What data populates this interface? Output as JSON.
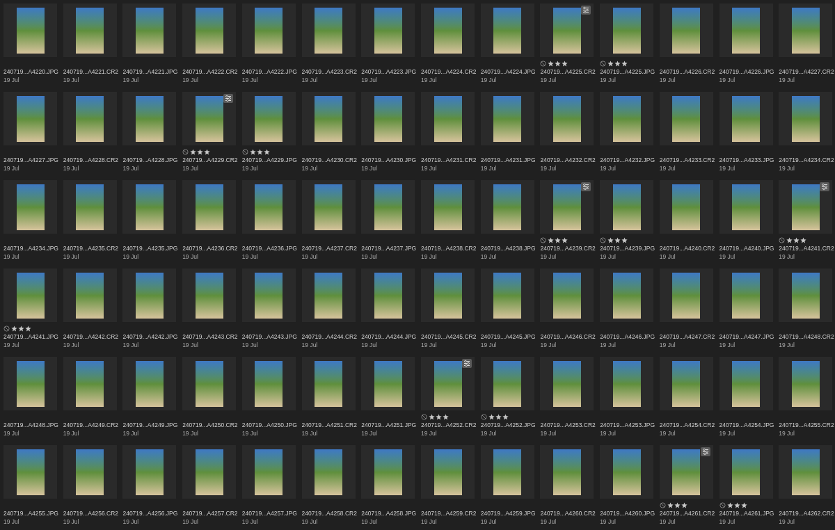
{
  "photos": [
    {
      "name": "240719...A4220.JPG",
      "date": "19 Jul",
      "edited": false
    },
    {
      "name": "240719...A4221.CR2",
      "date": "19 Jul",
      "edited": false
    },
    {
      "name": "240719...A4221.JPG",
      "date": "19 Jul",
      "edited": false
    },
    {
      "name": "240719...A4222.CR2",
      "date": "19 Jul",
      "edited": false
    },
    {
      "name": "240719...A4222.JPG",
      "date": "19 Jul",
      "edited": false
    },
    {
      "name": "240719...A4223.CR2",
      "date": "19 Jul",
      "edited": false
    },
    {
      "name": "240719...A4223.JPG",
      "date": "19 Jul",
      "edited": false
    },
    {
      "name": "240719...A4224.CR2",
      "date": "19 Jul",
      "edited": false
    },
    {
      "name": "240719...A4224.JPG",
      "date": "19 Jul",
      "edited": false
    },
    {
      "name": "240719...A4225.CR2",
      "date": "19 Jul",
      "edited": true,
      "stars": 3
    },
    {
      "name": "240719...A4225.JPG",
      "date": "19 Jul",
      "edited": false,
      "stars": 3
    },
    {
      "name": "240719...A4226.CR2",
      "date": "19 Jul",
      "edited": false
    },
    {
      "name": "240719...A4226.JPG",
      "date": "19 Jul",
      "edited": false
    },
    {
      "name": "240719...A4227.CR2",
      "date": "19 Jul",
      "edited": false
    },
    {
      "name": "240719...A4227.JPG",
      "date": "19 Jul",
      "edited": false
    },
    {
      "name": "240719...A4228.CR2",
      "date": "19 Jul",
      "edited": false
    },
    {
      "name": "240719...A4228.JPG",
      "date": "19 Jul",
      "edited": false
    },
    {
      "name": "240719...A4229.CR2",
      "date": "19 Jul",
      "edited": true,
      "stars": 3
    },
    {
      "name": "240719...A4229.JPG",
      "date": "19 Jul",
      "edited": false,
      "stars": 3
    },
    {
      "name": "240719...A4230.CR2",
      "date": "19 Jul",
      "edited": false
    },
    {
      "name": "240719...A4230.JPG",
      "date": "19 Jul",
      "edited": false
    },
    {
      "name": "240719...A4231.CR2",
      "date": "19 Jul",
      "edited": false
    },
    {
      "name": "240719...A4231.JPG",
      "date": "19 Jul",
      "edited": false
    },
    {
      "name": "240719...A4232.CR2",
      "date": "19 Jul",
      "edited": false
    },
    {
      "name": "240719...A4232.JPG",
      "date": "19 Jul",
      "edited": false
    },
    {
      "name": "240719...A4233.CR2",
      "date": "19 Jul",
      "edited": false
    },
    {
      "name": "240719...A4233.JPG",
      "date": "19 Jul",
      "edited": false
    },
    {
      "name": "240719...A4234.CR2",
      "date": "19 Jul",
      "edited": false
    },
    {
      "name": "240719...A4234.JPG",
      "date": "19 Jul",
      "edited": false
    },
    {
      "name": "240719...A4235.CR2",
      "date": "19 Jul",
      "edited": false
    },
    {
      "name": "240719...A4235.JPG",
      "date": "19 Jul",
      "edited": false
    },
    {
      "name": "240719...A4236.CR2",
      "date": "19 Jul",
      "edited": false
    },
    {
      "name": "240719...A4236.JPG",
      "date": "19 Jul",
      "edited": false
    },
    {
      "name": "240719...A4237.CR2",
      "date": "19 Jul",
      "edited": false
    },
    {
      "name": "240719...A4237.JPG",
      "date": "19 Jul",
      "edited": false
    },
    {
      "name": "240719...A4238.CR2",
      "date": "19 Jul",
      "edited": false
    },
    {
      "name": "240719...A4238.JPG",
      "date": "19 Jul",
      "edited": false
    },
    {
      "name": "240719...A4239.CR2",
      "date": "19 Jul",
      "edited": true,
      "stars": 3
    },
    {
      "name": "240719...A4239.JPG",
      "date": "19 Jul",
      "edited": false,
      "stars": 3
    },
    {
      "name": "240719...A4240.CR2",
      "date": "19 Jul",
      "edited": false
    },
    {
      "name": "240719...A4240.JPG",
      "date": "19 Jul",
      "edited": false
    },
    {
      "name": "240719...A4241.CR2",
      "date": "19 Jul",
      "edited": true,
      "stars": 3
    },
    {
      "name": "240719...A4241.JPG",
      "date": "19 Jul",
      "edited": false,
      "stars": 3
    },
    {
      "name": "240719...A4242.CR2",
      "date": "19 Jul",
      "edited": false
    },
    {
      "name": "240719...A4242.JPG",
      "date": "19 Jul",
      "edited": false
    },
    {
      "name": "240719...A4243.CR2",
      "date": "19 Jul",
      "edited": false
    },
    {
      "name": "240719...A4243.JPG",
      "date": "19 Jul",
      "edited": false
    },
    {
      "name": "240719...A4244.CR2",
      "date": "19 Jul",
      "edited": false
    },
    {
      "name": "240719...A4244.JPG",
      "date": "19 Jul",
      "edited": false
    },
    {
      "name": "240719...A4245.CR2",
      "date": "19 Jul",
      "edited": false
    },
    {
      "name": "240719...A4245.JPG",
      "date": "19 Jul",
      "edited": false
    },
    {
      "name": "240719...A4246.CR2",
      "date": "19 Jul",
      "edited": false
    },
    {
      "name": "240719...A4246.JPG",
      "date": "19 Jul",
      "edited": false
    },
    {
      "name": "240719...A4247.CR2",
      "date": "19 Jul",
      "edited": false
    },
    {
      "name": "240719...A4247.JPG",
      "date": "19 Jul",
      "edited": false
    },
    {
      "name": "240719...A4248.CR2",
      "date": "19 Jul",
      "edited": false
    },
    {
      "name": "240719...A4248.JPG",
      "date": "19 Jul",
      "edited": false
    },
    {
      "name": "240719...A4249.CR2",
      "date": "19 Jul",
      "edited": false
    },
    {
      "name": "240719...A4249.JPG",
      "date": "19 Jul",
      "edited": false
    },
    {
      "name": "240719...A4250.CR2",
      "date": "19 Jul",
      "edited": false
    },
    {
      "name": "240719...A4250.JPG",
      "date": "19 Jul",
      "edited": false
    },
    {
      "name": "240719...A4251.CR2",
      "date": "19 Jul",
      "edited": false
    },
    {
      "name": "240719...A4251.JPG",
      "date": "19 Jul",
      "edited": false
    },
    {
      "name": "240719...A4252.CR2",
      "date": "19 Jul",
      "edited": true,
      "stars": 3
    },
    {
      "name": "240719...A4252.JPG",
      "date": "19 Jul",
      "edited": false,
      "stars": 3
    },
    {
      "name": "240719...A4253.CR2",
      "date": "19 Jul",
      "edited": false
    },
    {
      "name": "240719...A4253.JPG",
      "date": "19 Jul",
      "edited": false
    },
    {
      "name": "240719...A4254.CR2",
      "date": "19 Jul",
      "edited": false
    },
    {
      "name": "240719...A4254.JPG",
      "date": "19 Jul",
      "edited": false
    },
    {
      "name": "240719...A4255.CR2",
      "date": "19 Jul",
      "edited": false
    },
    {
      "name": "240719...A4255.JPG",
      "date": "19 Jul",
      "edited": false
    },
    {
      "name": "240719...A4256.CR2",
      "date": "19 Jul",
      "edited": false
    },
    {
      "name": "240719...A4256.JPG",
      "date": "19 Jul",
      "edited": false
    },
    {
      "name": "240719...A4257.CR2",
      "date": "19 Jul",
      "edited": false
    },
    {
      "name": "240719...A4257.JPG",
      "date": "19 Jul",
      "edited": false
    },
    {
      "name": "240719...A4258.CR2",
      "date": "19 Jul",
      "edited": false
    },
    {
      "name": "240719...A4258.JPG",
      "date": "19 Jul",
      "edited": false
    },
    {
      "name": "240719...A4259.CR2",
      "date": "19 Jul",
      "edited": false
    },
    {
      "name": "240719...A4259.JPG",
      "date": "19 Jul",
      "edited": false
    },
    {
      "name": "240719...A4260.CR2",
      "date": "19 Jul",
      "edited": false
    },
    {
      "name": "240719...A4260.JPG",
      "date": "19 Jul",
      "edited": false
    },
    {
      "name": "240719...A4261.CR2",
      "date": "19 Jul",
      "edited": true,
      "stars": 3
    },
    {
      "name": "240719...A4261.JPG",
      "date": "19 Jul",
      "edited": false,
      "stars": 3
    },
    {
      "name": "240719...A4262.CR2",
      "date": "19 Jul",
      "edited": false
    }
  ]
}
